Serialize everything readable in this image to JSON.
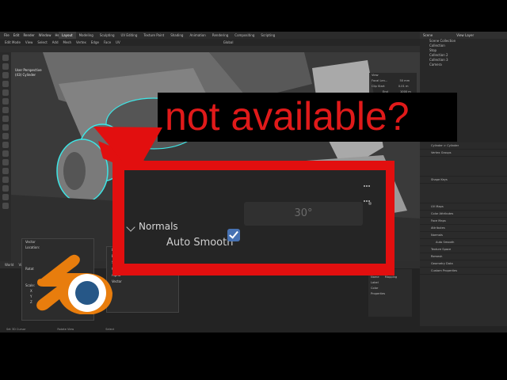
{
  "app": {
    "menu": [
      "File",
      "Edit",
      "Render",
      "Window",
      "Help"
    ],
    "workspace_tabs": [
      "Layout",
      "Modeling",
      "Sculpting",
      "UV Editing",
      "Texture Paint",
      "Shading",
      "Animation",
      "Rendering",
      "Compositing",
      "Scripting"
    ],
    "active_tab": "Layout",
    "scene": "Scene",
    "view_layer": "View Layer"
  },
  "viewport": {
    "mode": "Edit Mode",
    "menu": [
      "View",
      "Select",
      "Add",
      "Mesh",
      "Vertex",
      "Edge",
      "Face",
      "UV"
    ],
    "transform": "Global",
    "overlay_line1": "User Perspective",
    "overlay_line2": "(43) Cylinder"
  },
  "npanel": {
    "title": "View",
    "focal": "Focal Len...",
    "focal_val": "50 mm",
    "clip_start": "Clip Start",
    "clip_start_val": "0.01 m",
    "clip_end": "End",
    "clip_end_val": "1000 m"
  },
  "outliner": {
    "header": "Scene Collection",
    "items": [
      "Collection",
      "Stop",
      "Collection 2",
      "Collection 3",
      "Camera"
    ]
  },
  "properties": {
    "object": "Cylinder",
    "data": "Cylinder",
    "sections": [
      "Vertex Groups",
      "Shape Keys",
      "UV Maps",
      "Color Attributes",
      "Face Maps",
      "Attributes",
      "Normals",
      "Texture Space",
      "Remesh",
      "Geometry Data",
      "Custom Properties"
    ],
    "auto_smooth": "Auto Smooth"
  },
  "node_editor": {
    "menu": [
      "View",
      "Select",
      "Add",
      "Node"
    ],
    "use_nodes": "Use Nodes",
    "world": "World",
    "panel_title": "Node",
    "name_label": "Name",
    "name_val": "Mapping",
    "label_label": "Label",
    "color": "Color",
    "properties": "Properties"
  },
  "float_panel": {
    "title": "Vector",
    "location": "Location:",
    "rotation": "Rotat",
    "scale": "Scale:",
    "x": "X",
    "y": "Y",
    "z": "Z",
    "y_val": "1.000",
    "z_val": "1.000"
  },
  "float_panel2": {
    "items": [
      "Lin",
      "Ep",
      "Singl",
      "Color Sp",
      "Alpha",
      "Vector"
    ]
  },
  "status": {
    "left": "Set 3D Cursor",
    "mid1": "Rotate View",
    "mid2": "Select"
  },
  "callout": {
    "text": "not available?",
    "color": "#e01a1a"
  },
  "zoom": {
    "section": "Normals",
    "auto_smooth": "Auto Smooth",
    "angle": "30°"
  },
  "colors": {
    "accent": "#4772b3",
    "highlight_red": "#e20f0f",
    "blender_orange": "#e87d0d",
    "blender_blue": "#265787"
  }
}
